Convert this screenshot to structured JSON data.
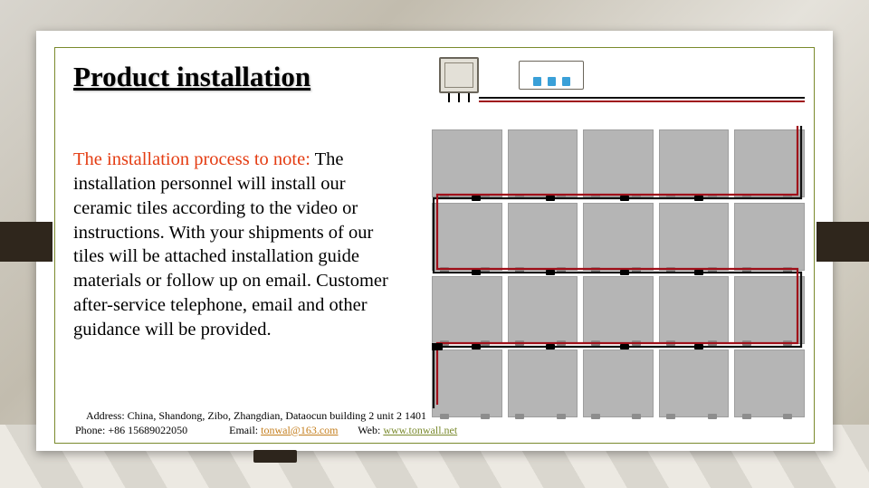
{
  "title": "Product installation",
  "note_label": "The installation process to note:",
  "body": " The installation personnel will install our ceramic tiles according to the video or instructions. With your shipments of our tiles will be attached installation guide materials or follow up on email. Customer after-service telephone, email and other guidance will be provided.",
  "footer": {
    "address_label": "Address:",
    "address": " China, Shandong, Zibo, Zhangdian, Dataocun building 2 unit 2 1401",
    "phone_label": "Phone:",
    "phone": " +86 15689022050",
    "email_label": "Email:",
    "email": "tonwal@163.com",
    "web_label": "Web:",
    "web": "www.tonwall.net"
  },
  "diagram": {
    "rows": 4,
    "cols": 5
  }
}
